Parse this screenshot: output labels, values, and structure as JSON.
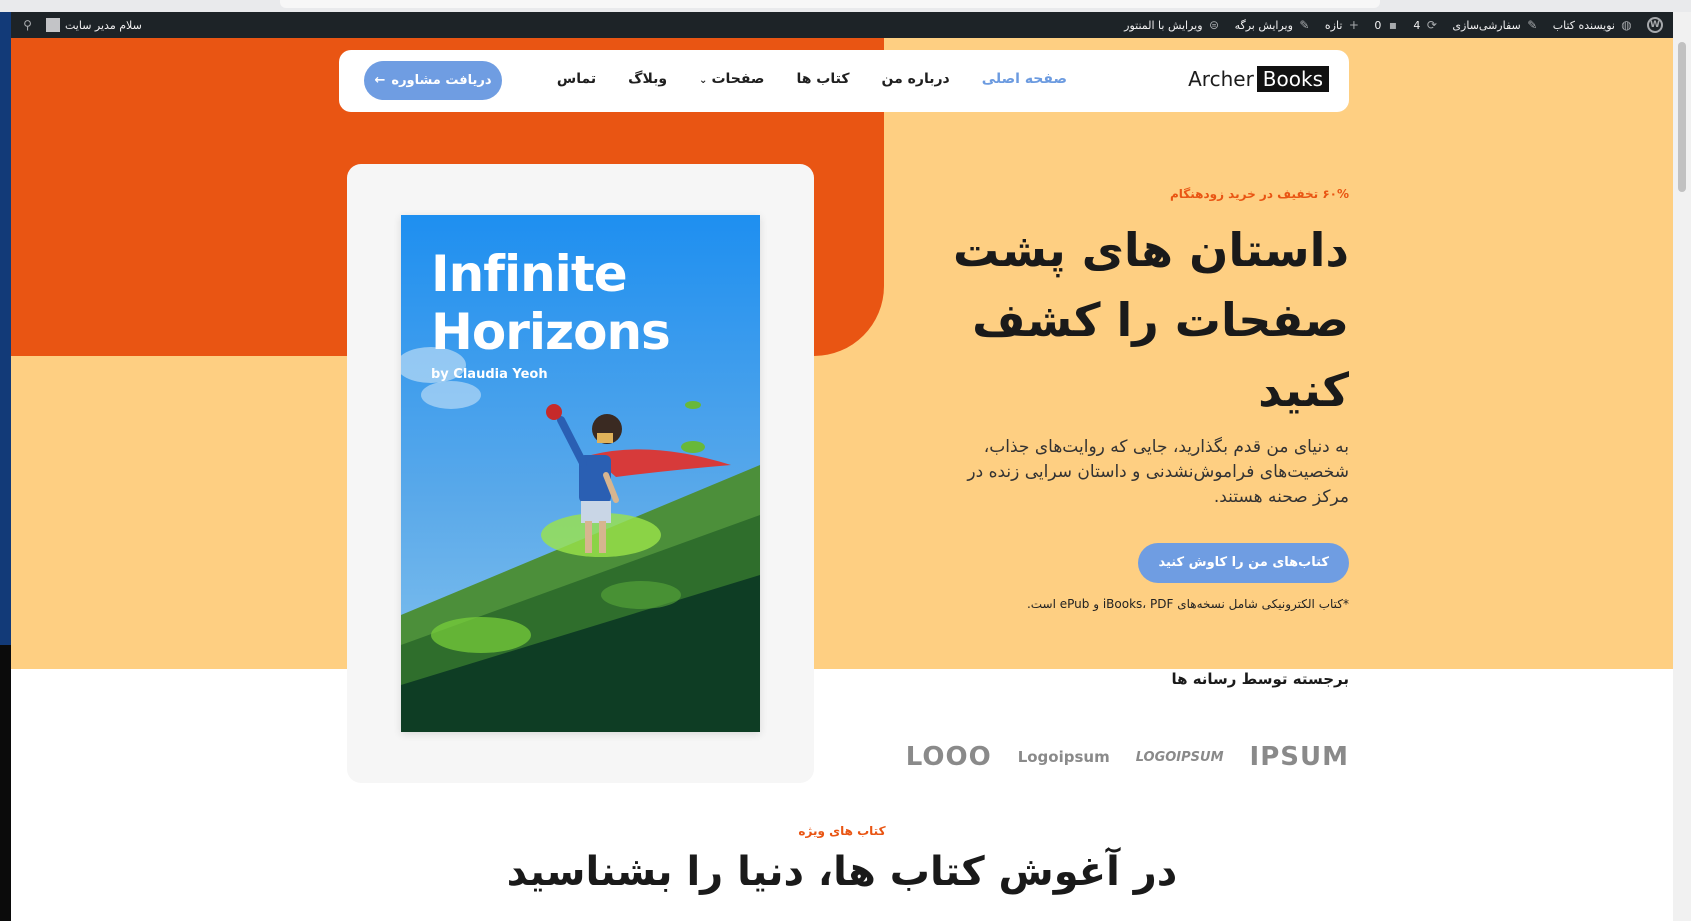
{
  "admin_bar": {
    "site_name": "نویسنده کتاب",
    "customize": "سفارشی‌سازی",
    "updates_count": "4",
    "comments_count": "0",
    "new_label": "تازه",
    "edit_page": "ویرایش برگه",
    "edit_elementor": "ویرایش با المنتور",
    "greeting": "سلام مدیر سایت"
  },
  "nav": {
    "brand_part1": "Archer",
    "brand_part2": "Books",
    "items": [
      {
        "label": "صفحه اصلی",
        "active": true
      },
      {
        "label": "درباره من"
      },
      {
        "label": "کتاب ها"
      },
      {
        "label": "صفحات",
        "has_dropdown": true
      },
      {
        "label": "وبلاگ"
      },
      {
        "label": "تماس"
      }
    ],
    "cta_label": "دریافت مشاوره"
  },
  "hero": {
    "promo": "۶۰% تخفیف در خرید زودهنگام",
    "headline": "داستان های پشت صفحات را کشف کنید",
    "subtext": "به دنیای من قدم بگذارید، جایی که روایت‌های جذاب، شخصیت‌های فراموش‌نشدنی و داستان سرایی زنده در مرکز صحنه هستند.",
    "cta_label": "کتاب‌های من را کاوش کنید",
    "note": "*کتاب الکترونیکی شامل نسخه‌های iBooks، PDF و ePub است."
  },
  "book": {
    "title_line1": "Infinite",
    "title_line2": "Horizons",
    "author": "by Claudia Yeoh"
  },
  "featured": {
    "title": "برجسته توسط رسانه ها",
    "logos": [
      "IPSUM",
      "LOGOIPSUM",
      "Logoipsum",
      "LOOO"
    ]
  },
  "special": {
    "label": "کتاب های ویژه",
    "title": "در آغوش کتاب ها، دنیا را بشناسید"
  },
  "colors": {
    "orange": "#e95513",
    "yellow": "#fecf82",
    "accent_blue": "#6f9de2",
    "admin_bar": "#1d2327"
  }
}
